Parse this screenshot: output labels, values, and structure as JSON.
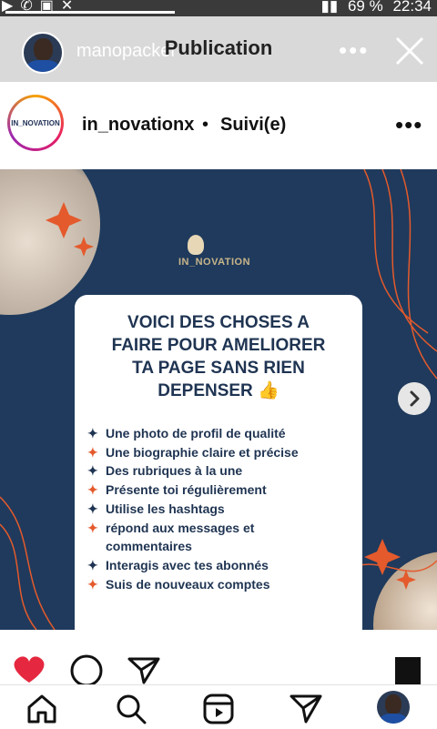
{
  "status_bar": {
    "battery": "69 %",
    "time": "22:34"
  },
  "story": {
    "username": "manopacker",
    "title": "Publication"
  },
  "post": {
    "username": "in_novationx",
    "separator": "•",
    "follow_label": "Suivi(e)",
    "brand_logo": {
      "text": "IN_NOVATION"
    }
  },
  "image_card": {
    "heading_lines": [
      "VOICI DES CHOSES A",
      "FAIRE POUR AMELIORER",
      "TA PAGE SANS RIEN",
      "DEPENSER"
    ],
    "thumbs_emoji": "👍",
    "tips": [
      "Une photo de profil de qualité",
      "Une biographie claire et précise",
      "Des rubriques à la une",
      "Présente toi régulièrement",
      "Utilise les hashtags",
      "répond aux messages et",
      "commentaires",
      "Interagis avec tes abonnés",
      "Suis de nouveaux comptes"
    ]
  },
  "icons": {
    "like": "heart-icon",
    "comment": "comment-icon",
    "share": "send-icon",
    "save": "bookmark-icon",
    "next": "chevron-right-icon",
    "home": "home-icon",
    "search": "search-icon",
    "reels": "reels-icon",
    "direct": "send-icon",
    "profile": "avatar"
  },
  "colors": {
    "background_navy": "#1f3a5c",
    "card_text_navy": "#1f3452",
    "accent_orange": "#e45a2c",
    "like_red": "#e5283f"
  }
}
